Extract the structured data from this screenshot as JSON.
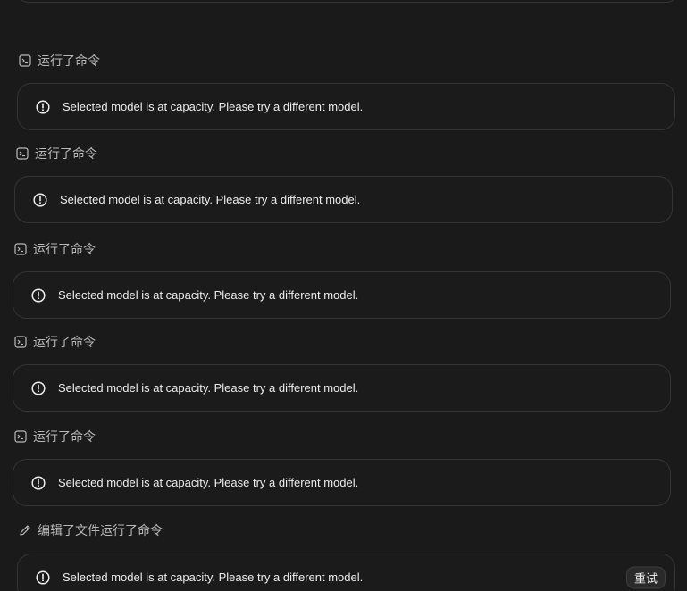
{
  "colors": {
    "background": "#1a1a1a",
    "card_border": "#343434",
    "label_text": "#b9b9b9",
    "message_text": "#ededed"
  },
  "steps": [
    {
      "label": "运行了命令",
      "icon": "terminal-icon",
      "message": "Selected model is at capacity. Please try a different model."
    },
    {
      "label": "运行了命令",
      "icon": "terminal-icon",
      "message": "Selected model is at capacity. Please try a different model."
    },
    {
      "label": "运行了命令",
      "icon": "terminal-icon",
      "message": "Selected model is at capacity. Please try a different model."
    },
    {
      "label": "运行了命令",
      "icon": "terminal-icon",
      "message": "Selected model is at capacity. Please try a different model."
    },
    {
      "label": "运行了命令",
      "icon": "terminal-icon",
      "message": "Selected model is at capacity. Please try a different model."
    },
    {
      "label": "编辑了文件运行了命令",
      "icon": "pencil-icon",
      "message": "Selected model is at capacity. Please try a different model.",
      "retry_label": "重试"
    }
  ]
}
